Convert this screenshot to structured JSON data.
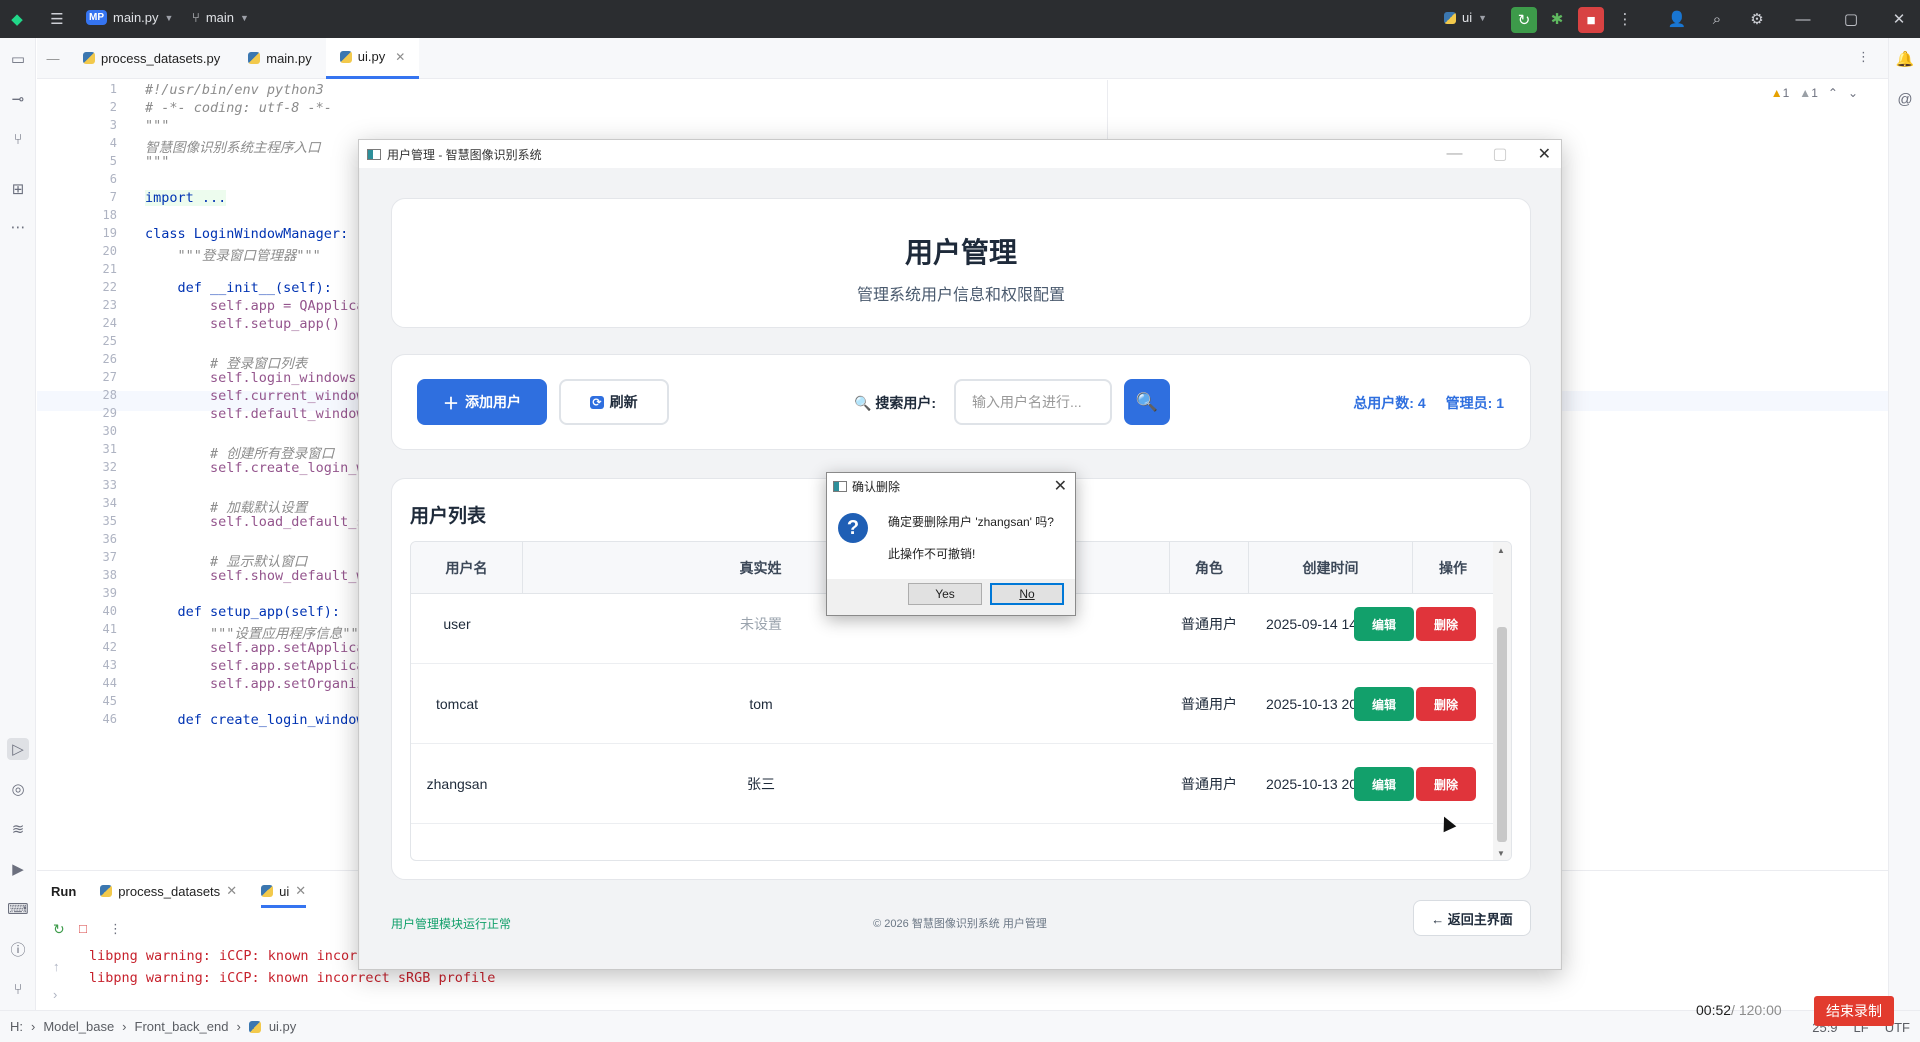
{
  "ide": {
    "project_badge": "MP",
    "project_file": "main.py",
    "branch": "main",
    "run_config": "ui",
    "tabs": [
      {
        "label": "process_datasets.py"
      },
      {
        "label": "main.py"
      },
      {
        "label": "ui.py"
      }
    ],
    "warnings": [
      "1",
      "1"
    ],
    "code_lines": [
      {
        "n": "1",
        "text": "#!/usr/bin/env python3"
      },
      {
        "n": "2",
        "text": "# -*- coding: utf-8 -*-"
      },
      {
        "n": "3",
        "text": "\"\"\""
      },
      {
        "n": "4",
        "text": "智慧图像识别系统主程序入口"
      },
      {
        "n": "5",
        "text": "\"\"\""
      },
      {
        "n": "6",
        "text": ""
      },
      {
        "n": "7",
        "text": "import ..."
      },
      {
        "n": "18",
        "text": ""
      },
      {
        "n": "19",
        "text": "class LoginWindowManager:"
      },
      {
        "n": "20",
        "text": "    \"\"\"登录窗口管理器\"\"\""
      },
      {
        "n": "21",
        "text": ""
      },
      {
        "n": "22",
        "text": "    def __init__(self):"
      },
      {
        "n": "23",
        "text": "        self.app = QApplica"
      },
      {
        "n": "24",
        "text": "        self.setup_app()"
      },
      {
        "n": "25",
        "text": ""
      },
      {
        "n": "26",
        "text": "        # 登录窗口列表"
      },
      {
        "n": "27",
        "text": "        self.login_windows"
      },
      {
        "n": "28",
        "text": "        self.current_window"
      },
      {
        "n": "29",
        "text": "        self.default_window"
      },
      {
        "n": "30",
        "text": ""
      },
      {
        "n": "31",
        "text": "        # 创建所有登录窗口"
      },
      {
        "n": "32",
        "text": "        self.create_login_w"
      },
      {
        "n": "33",
        "text": ""
      },
      {
        "n": "34",
        "text": "        # 加载默认设置"
      },
      {
        "n": "35",
        "text": "        self.load_default_s"
      },
      {
        "n": "36",
        "text": ""
      },
      {
        "n": "37",
        "text": "        # 显示默认窗口"
      },
      {
        "n": "38",
        "text": "        self.show_default_w"
      },
      {
        "n": "39",
        "text": ""
      },
      {
        "n": "40",
        "text": "    def setup_app(self):"
      },
      {
        "n": "41",
        "text": "        \"\"\"设置应用程序信息\"\"\""
      },
      {
        "n": "42",
        "text": "        self.app.setApplica"
      },
      {
        "n": "43",
        "text": "        self.app.setApplica"
      },
      {
        "n": "44",
        "text": "        self.app.setOrganiz"
      },
      {
        "n": "45",
        "text": ""
      },
      {
        "n": "46",
        "text": "    def create_login_window"
      }
    ],
    "run_panel": {
      "label": "Run",
      "tabs": [
        "process_datasets",
        "ui"
      ],
      "console": [
        "libpng warning: iCCP: known incorr",
        "libpng warning: iCCP: known incorrect sRGB profile"
      ]
    },
    "breadcrumb": [
      "H:",
      "Model_base",
      "Front_back_end",
      "ui.py"
    ],
    "status": {
      "position": "25:9",
      "line_ending": "LF",
      "encoding": "UTF"
    },
    "timer": {
      "elapsed": "00:52",
      "total": "/ 120:00"
    },
    "stop_record": "结束录制"
  },
  "app": {
    "window_title": "用户管理 - 智慧图像识别系统",
    "header": {
      "title": "用户管理",
      "subtitle": "管理系统用户信息和权限配置"
    },
    "toolbar": {
      "add_user": "添加用户",
      "refresh": "刷新",
      "search_label": "搜索用户:",
      "search_placeholder": "输入用户名进行...",
      "total_users": "总用户数: 4",
      "admins": "管理员: 1"
    },
    "list": {
      "title": "用户列表",
      "columns": [
        "用户名",
        "真实姓",
        "角色",
        "创建时间",
        "操作"
      ],
      "rows": [
        {
          "username": "user",
          "realname": "未设置",
          "role": "普通用户",
          "created": "2025-09-14 14:23:59",
          "edit": "编辑",
          "delete": "删除"
        },
        {
          "username": "tomcat",
          "realname": "tom",
          "role": "普通用户",
          "created": "2025-10-13 20:32:27",
          "edit": "编辑",
          "delete": "删除"
        },
        {
          "username": "zhangsan",
          "realname": "张三",
          "role": "普通用户",
          "created": "2025-10-13 20:36:03",
          "edit": "编辑",
          "delete": "删除"
        }
      ]
    },
    "footer": {
      "status": "用户管理模块运行正常",
      "copyright": "© 2026 智慧图像识别系统  用户管理",
      "back": "← 返回主界面"
    }
  },
  "dialog": {
    "title": "确认删除",
    "message": "确定要删除用户 'zhangsan' 吗?",
    "warning": "此操作不可撤销!",
    "yes": "Yes",
    "no": "No"
  }
}
